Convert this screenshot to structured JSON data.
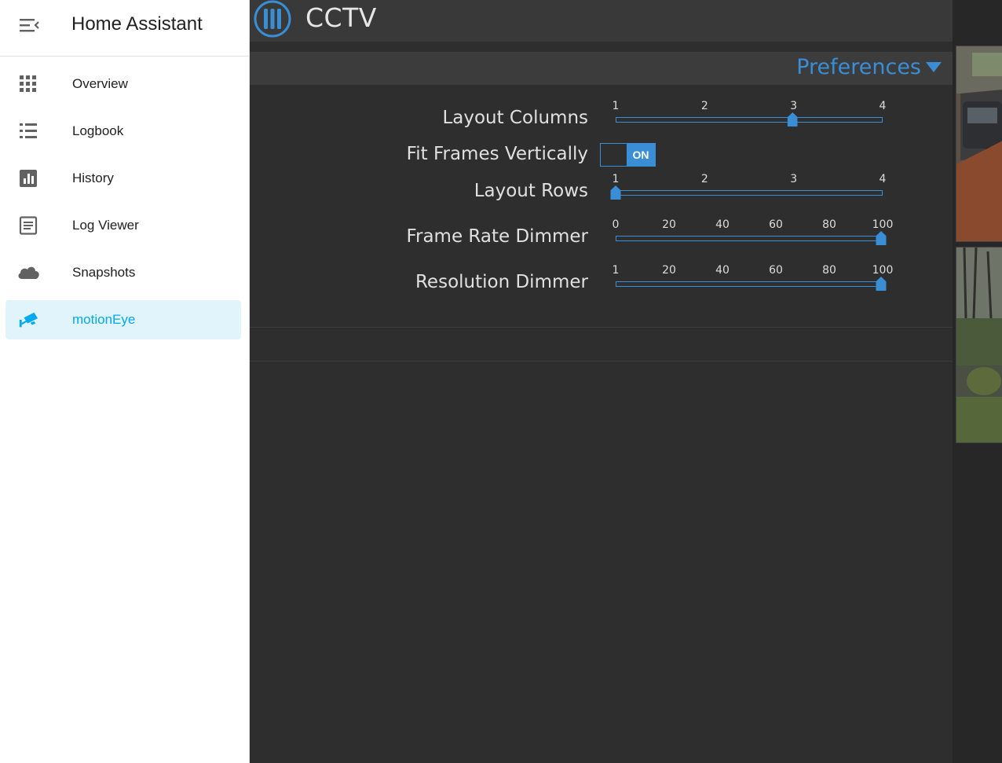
{
  "sidebar": {
    "title": "Home Assistant",
    "items": [
      {
        "label": "Overview",
        "icon": "grid-icon"
      },
      {
        "label": "Logbook",
        "icon": "list-icon"
      },
      {
        "label": "History",
        "icon": "chart-icon"
      },
      {
        "label": "Log Viewer",
        "icon": "document-icon"
      },
      {
        "label": "Snapshots",
        "icon": "cloud-icon"
      },
      {
        "label": "motionEye",
        "icon": "cctv-camera-icon",
        "active": true
      }
    ]
  },
  "header": {
    "title": "CCTV"
  },
  "preferences": {
    "label": "Preferences",
    "layout_columns": {
      "label": "Layout Columns",
      "ticks": [
        "1",
        "2",
        "3",
        "4"
      ],
      "value": 3,
      "min": 1,
      "max": 4
    },
    "fit_frames": {
      "label": "Fit Frames Vertically",
      "state": "ON"
    },
    "layout_rows": {
      "label": "Layout Rows",
      "ticks": [
        "1",
        "2",
        "3",
        "4"
      ],
      "value": 1,
      "min": 1,
      "max": 4
    },
    "frame_rate_dimmer": {
      "label": "Frame Rate Dimmer",
      "ticks": [
        "0",
        "20",
        "40",
        "60",
        "80",
        "100"
      ],
      "value": 100,
      "min": 0,
      "max": 100
    },
    "resolution_dimmer": {
      "label": "Resolution Dimmer",
      "ticks": [
        "1",
        "20",
        "40",
        "60",
        "80",
        "100"
      ],
      "value": 100,
      "min": 1,
      "max": 100
    }
  },
  "colors": {
    "accent": "#3a8ed6",
    "sidebar_active": "#03a9f4",
    "active_bg": "#e1f4fb"
  }
}
